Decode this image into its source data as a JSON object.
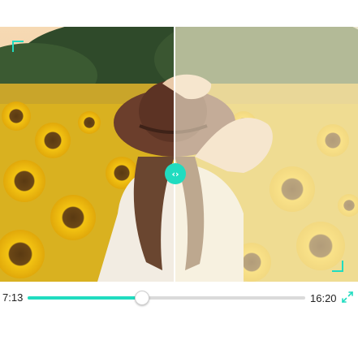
{
  "player": {
    "current_time": "7:13",
    "total_time": "16:20",
    "progress": 0.41
  },
  "compare": {
    "split_position": 0.488,
    "handle_icon": "left-right-arrows-icon"
  },
  "image": {
    "description_tag": "woman-in-sunflower-field"
  },
  "colors": {
    "accent": "#20dcc0",
    "track": "#dadada",
    "time_text": "#222222"
  },
  "icons": {
    "fullscreen": "expand-icon"
  }
}
